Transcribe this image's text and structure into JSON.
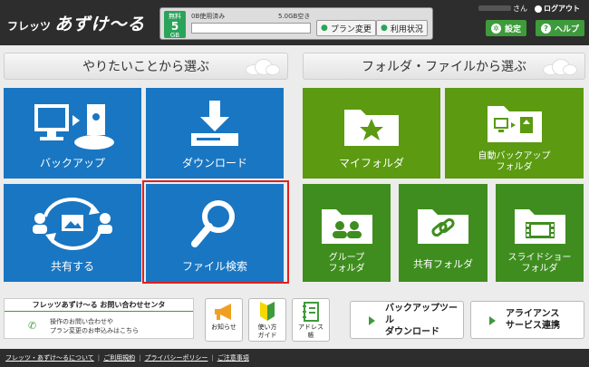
{
  "header": {
    "logo_small": "フレッツ",
    "logo_big": "あずけ〜る",
    "plan": {
      "line1": "無料",
      "line2": "5",
      "line3": "GB"
    },
    "used_text": "0B使用済み",
    "free_text": "5.0GB空き",
    "usage_fraction": 0,
    "plan_change": "プラン変更",
    "usage_status": "利用状況",
    "user_suffix": "さん",
    "logout": "ログアウト",
    "settings": "設定",
    "help": "ヘルプ"
  },
  "left_section": {
    "title": "やりたいことから選ぶ"
  },
  "right_section": {
    "title": "フォルダ・ファイルから選ぶ"
  },
  "tiles_left": {
    "backup": "バックアップ",
    "download": "ダウンロード",
    "share": "共有する",
    "search": "ファイル検索"
  },
  "tiles_right": {
    "my_folder": "マイフォルダ",
    "auto_backup_1": "自動バックアップ",
    "auto_backup_2": "フォルダ",
    "group_1": "グループ",
    "group_2": "フォルダ",
    "share_folder": "共有フォルダ",
    "slideshow_1": "スライドショー",
    "slideshow_2": "フォルダ"
  },
  "contact": {
    "title": "フレッツあずけ〜る お問い合わせセンタ",
    "line1": "操作のお問い合わせや",
    "line2": "プラン変更のお申込みはこちら"
  },
  "small_buttons": {
    "news": "お知らせ",
    "guide_1": "使い方",
    "guide_2": "ガイド",
    "address_1": "アドレス",
    "address_2": "帳"
  },
  "wide_buttons": {
    "backup_tool_1": "バックアップツール",
    "backup_tool_2": "ダウンロード",
    "alliance_1": "アライアンス",
    "alliance_2": "サービス連携"
  },
  "footer": {
    "about": "フレッツ・あずけ〜るについて",
    "terms": "ご利用規約",
    "privacy": "プライバシーポリシー",
    "notes": "ご注意事項"
  }
}
